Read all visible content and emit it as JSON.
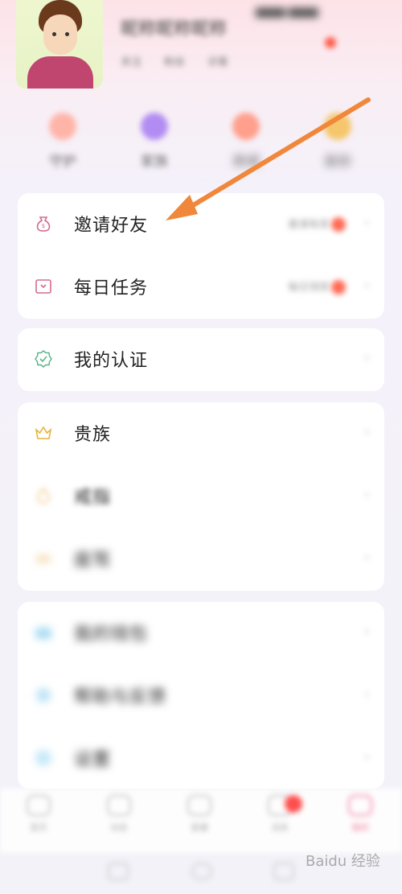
{
  "header": {
    "nickname": "昵称昵称昵称",
    "meta": [
      "关注",
      "粉丝",
      "访客"
    ],
    "top_right": "▇▇▇▇ ▇▇▇▇"
  },
  "quick_actions": [
    {
      "label": "守护",
      "color": "#ffb4a8"
    },
    {
      "label": "家族",
      "color": "#b28cf2"
    },
    {
      "label": "商城",
      "color": "#ff9f8c"
    },
    {
      "label": "装扮",
      "color": "#f5c66b"
    }
  ],
  "menu_group_1": [
    {
      "label": "邀请好友",
      "extra": "邀请有奖",
      "icon": "money-bag-icon"
    },
    {
      "label": "每日任务",
      "extra": "每日领奖",
      "icon": "task-box-icon"
    }
  ],
  "menu_group_2": [
    {
      "label": "我的认证",
      "icon": "badge-check-icon"
    }
  ],
  "menu_group_3": [
    {
      "label": "贵族",
      "icon": "crown-icon"
    },
    {
      "label": "戒指",
      "icon": "ring-icon"
    },
    {
      "label": "座驾",
      "icon": "car-icon"
    }
  ],
  "menu_group_4": [
    {
      "label": "我的钱包",
      "icon": "wallet-icon"
    },
    {
      "label": "帮助与反馈",
      "icon": "help-icon"
    },
    {
      "label": "设置",
      "icon": "settings-icon"
    }
  ],
  "bottom_nav": [
    {
      "label": "首页"
    },
    {
      "label": "动态"
    },
    {
      "label": "直播"
    },
    {
      "label": "消息"
    },
    {
      "label": "我的"
    }
  ],
  "watermark": "Baidu 经验",
  "colors": {
    "accent_arrow": "#f0873a",
    "red_dot": "#ff6a55",
    "crown": "#e9b23b",
    "badge": "#5bb58a",
    "pink_icon": "#d36d8c"
  }
}
